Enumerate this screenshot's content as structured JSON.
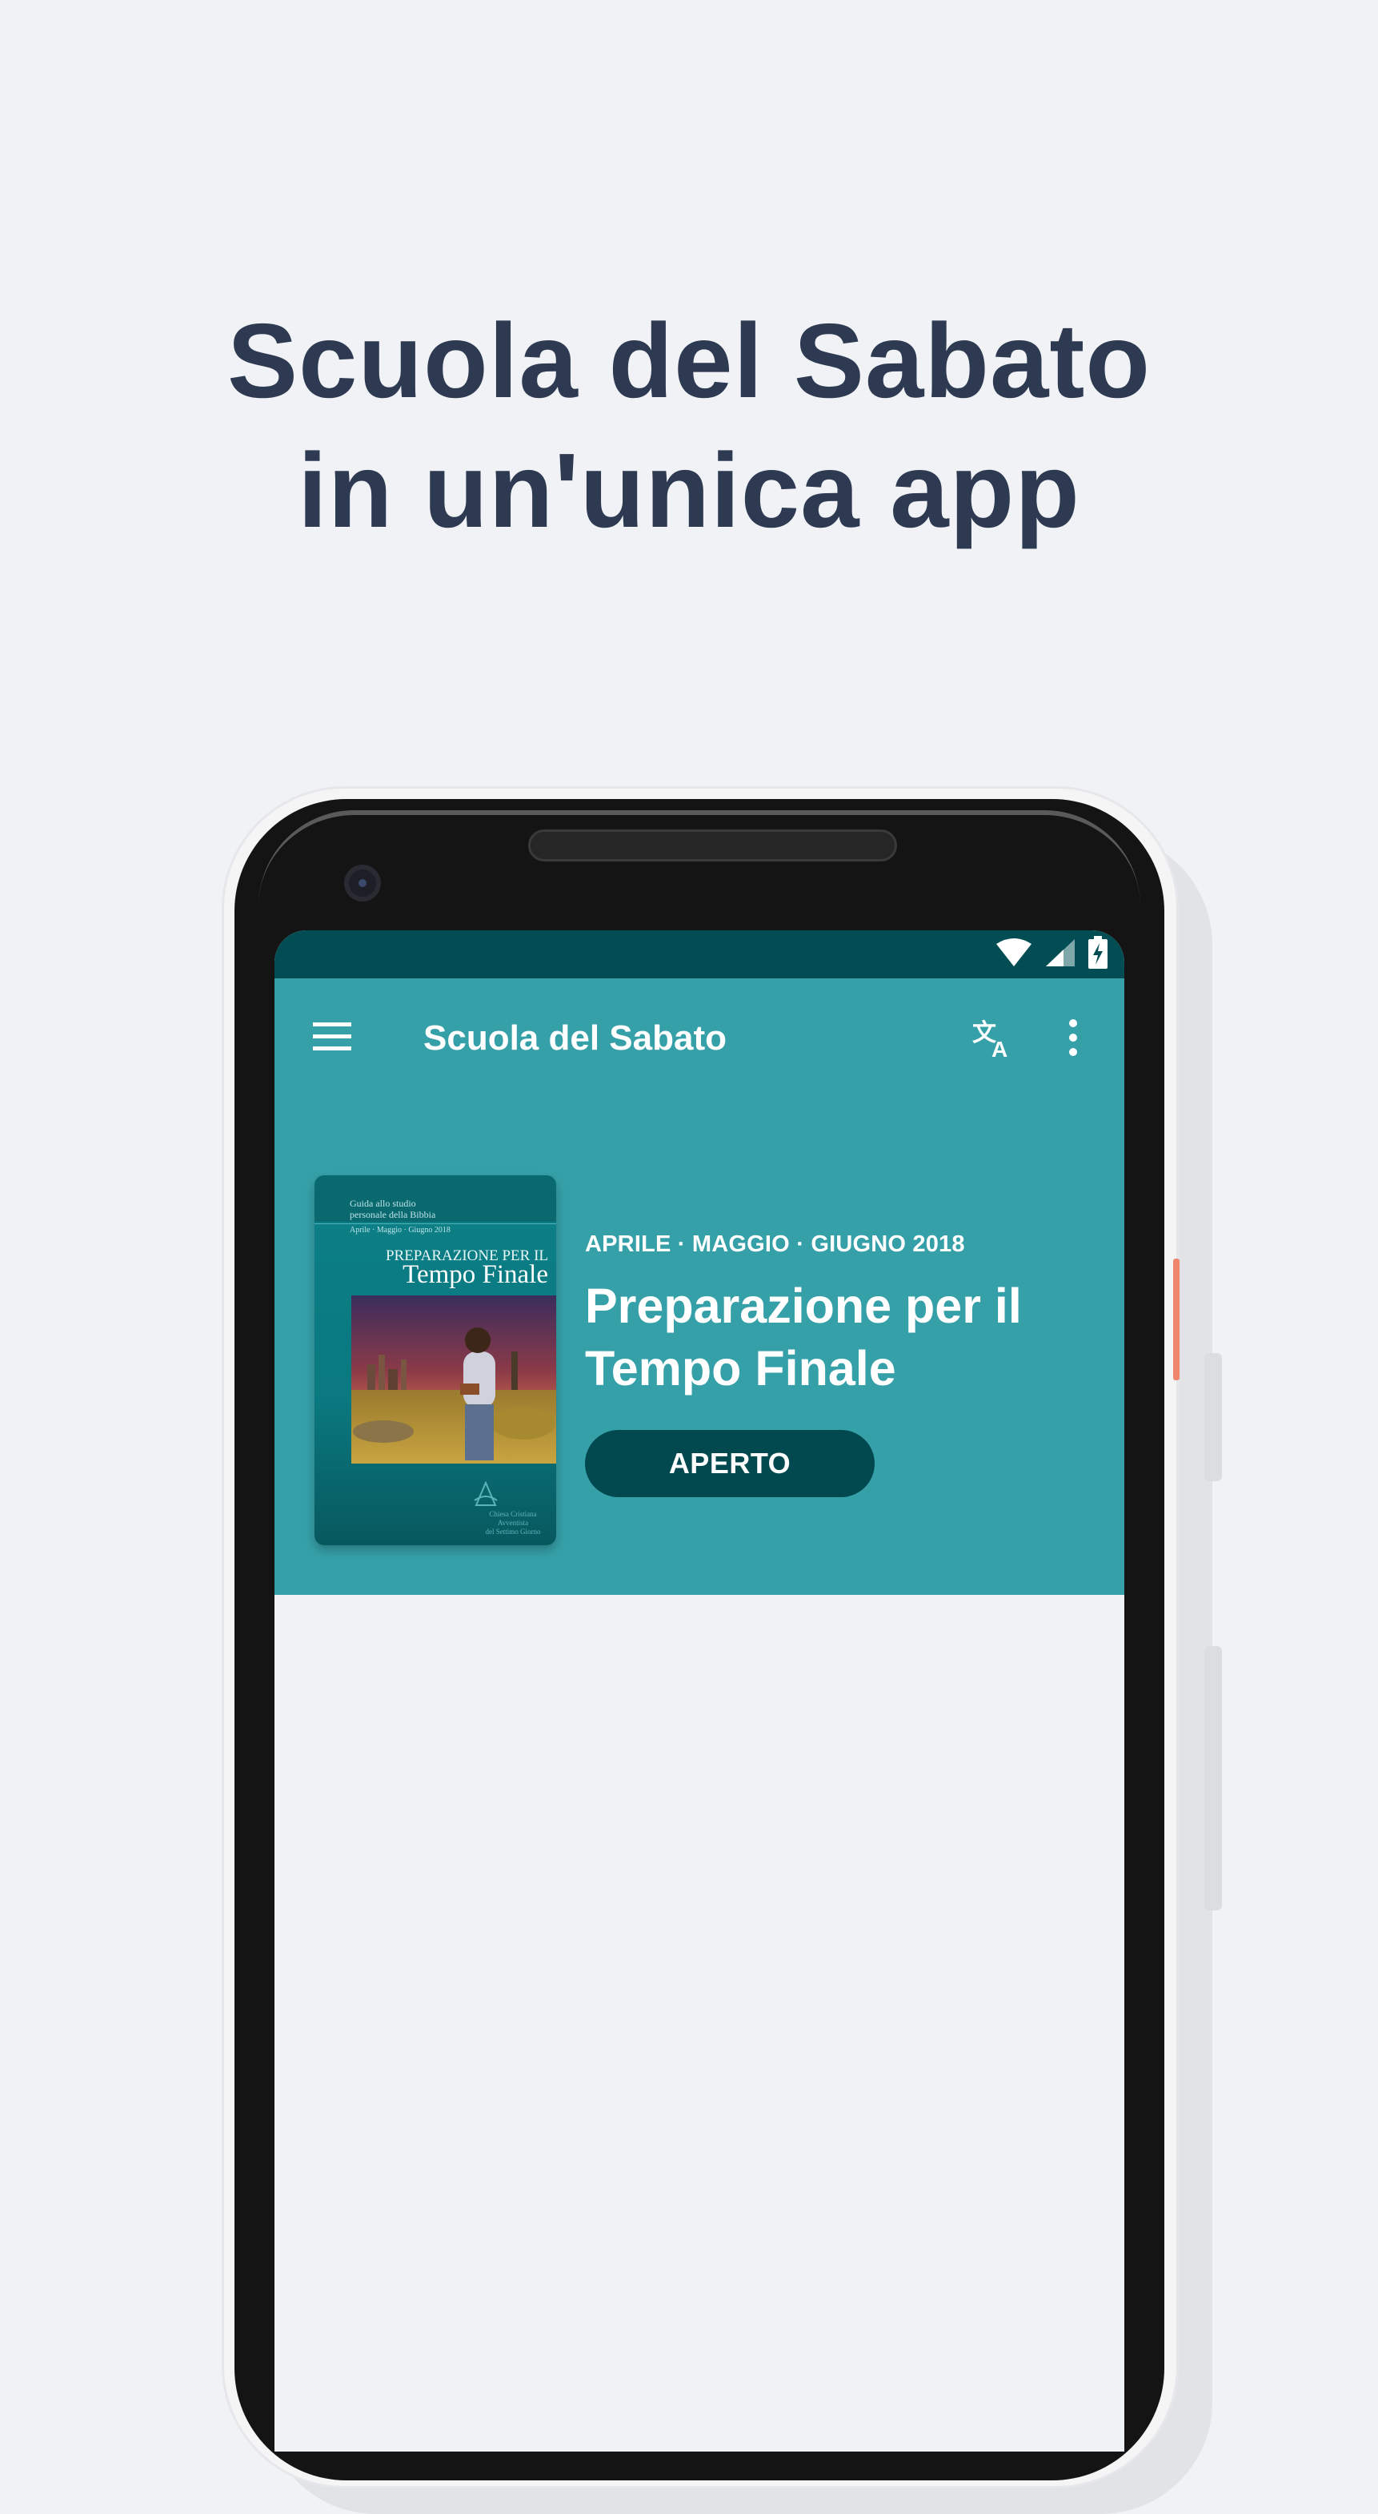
{
  "headline": {
    "line1": "Scuola del Sabato",
    "line2": "in un'unica app"
  },
  "status_bar": {
    "icons": [
      "wifi-icon",
      "cell-signal-icon",
      "battery-charging-icon"
    ]
  },
  "toolbar": {
    "title": "Scuola del Sabato",
    "menu_icon": "hamburger-menu-icon",
    "translate_icon": "translate-icon",
    "more_icon": "more-vert-icon"
  },
  "featured": {
    "dates": "APRILE · MAGGIO · GIUGNO 2018",
    "title": "Preparazione per il Tempo Finale",
    "open_label": "APERTO",
    "cover": {
      "top_line1": "Guida allo studio",
      "top_line2": "personale della Bibbia",
      "period": "Aprile · Maggio · Giugno 2018",
      "subtitle": "PREPARAZIONE PER IL",
      "title": "Tempo Finale",
      "publisher_line1": "Chiesa Cristiana Avventista",
      "publisher_line2": "del Settimo Giorno"
    }
  },
  "colors": {
    "background": "#f0f2f5",
    "headline": "#2e3a52",
    "status_bar": "#014d53",
    "app_bar": "#36a0a8",
    "button": "#02484f"
  }
}
